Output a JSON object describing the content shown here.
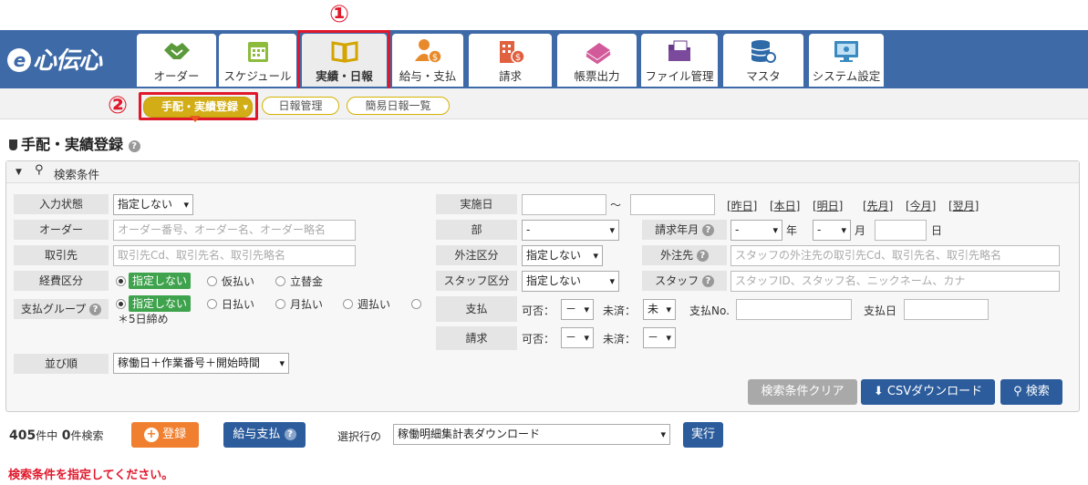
{
  "app": {
    "logo_text": "心伝心",
    "logo_e": "e"
  },
  "nav": {
    "tabs": [
      {
        "label": "オーダー",
        "icon": "handshake-icon"
      },
      {
        "label": "スケジュール",
        "icon": "calendar-icon"
      },
      {
        "label": "実績・日報",
        "icon": "book-icon"
      },
      {
        "label": "給与・支払",
        "icon": "person-money-icon"
      },
      {
        "label": "請求",
        "icon": "building-money-icon"
      },
      {
        "label": "帳票出力",
        "icon": "documents-icon"
      },
      {
        "label": "ファイル管理",
        "icon": "folder-icon"
      },
      {
        "label": "マスタ",
        "icon": "database-gear-icon"
      },
      {
        "label": "システム設定",
        "icon": "monitor-gear-icon"
      }
    ]
  },
  "annotations": {
    "one": "①",
    "two": "②"
  },
  "subnav": {
    "items": [
      "手配・実績登録",
      "日報管理",
      "簡易日報一覧"
    ]
  },
  "page": {
    "title": "手配・実績登録"
  },
  "search": {
    "header": "検索条件",
    "labels": {
      "input_status": "入力状態",
      "order": "オーダー",
      "client": "取引先",
      "expense": "経費区分",
      "pay_group": "支払グループ",
      "sort": "並び順",
      "date": "実施日",
      "dept": "部",
      "bill_month": "請求年月",
      "outsource": "外注区分",
      "outsourcer": "外注先",
      "staff_type": "スタッフ区分",
      "staff": "スタッフ",
      "payment": "支払",
      "billing": "請求"
    },
    "input_status_value": "指定しない",
    "order_placeholder": "オーダー番号、オーダー名、オーダー略名",
    "client_placeholder": "取引先Cd、取引先名、取引先略名",
    "expense_options": [
      "指定しない",
      "仮払い",
      "立替金"
    ],
    "pay_group_options": [
      "指定しない",
      "日払い",
      "月払い",
      "週払い"
    ],
    "pay_group_note": "＊5日締め",
    "sort_value": "稼働日＋作業番号＋開始時間",
    "date_sep": "〜",
    "date_links": [
      "[昨日]",
      "[本日]",
      "[明日]",
      "[先月]",
      "[今月]",
      "[翌月]"
    ],
    "dept_value": "-",
    "year_value": "-",
    "year_unit": "年",
    "month_value": "-",
    "month_unit": "月",
    "day_unit": "日",
    "outsource_value": "指定しない",
    "outsourcer_placeholder": "スタッフの外注先の取引先Cd、取引先名、取引先略名",
    "staff_type_value": "指定しない",
    "staff_placeholder": "スタッフID、スタッフ名、ニックネーム、カナ",
    "pay_kahi_label": "可否：",
    "pay_kahi_value": "－",
    "pay_misumi_label": "未済：",
    "pay_misumi_value": "未",
    "pay_no_label": "支払No.",
    "pay_date_label": "支払日",
    "bill_kahi_label": "可否：",
    "bill_kahi_value": "－",
    "bill_misumi_label": "未済：",
    "bill_misumi_value": "－",
    "clear_button": "検索条件クリア",
    "csv_button": "CSVダウンロード",
    "search_button": "検索"
  },
  "results": {
    "total": "405",
    "total_unit": "件中",
    "found": "0",
    "found_unit": "件検索",
    "register_button": "登録",
    "salary_button": "給与支払",
    "selected_label": "選択行の",
    "action_value": "稼働明細集計表ダウンロード",
    "run_button": "実行"
  },
  "message": "検索条件を指定してください。",
  "colors": {
    "header": "#3e6aa8",
    "highlight": "#e0182c",
    "pill": "#d2ad16",
    "button_blue": "#2c5c9c",
    "button_orange": "#f08030"
  }
}
